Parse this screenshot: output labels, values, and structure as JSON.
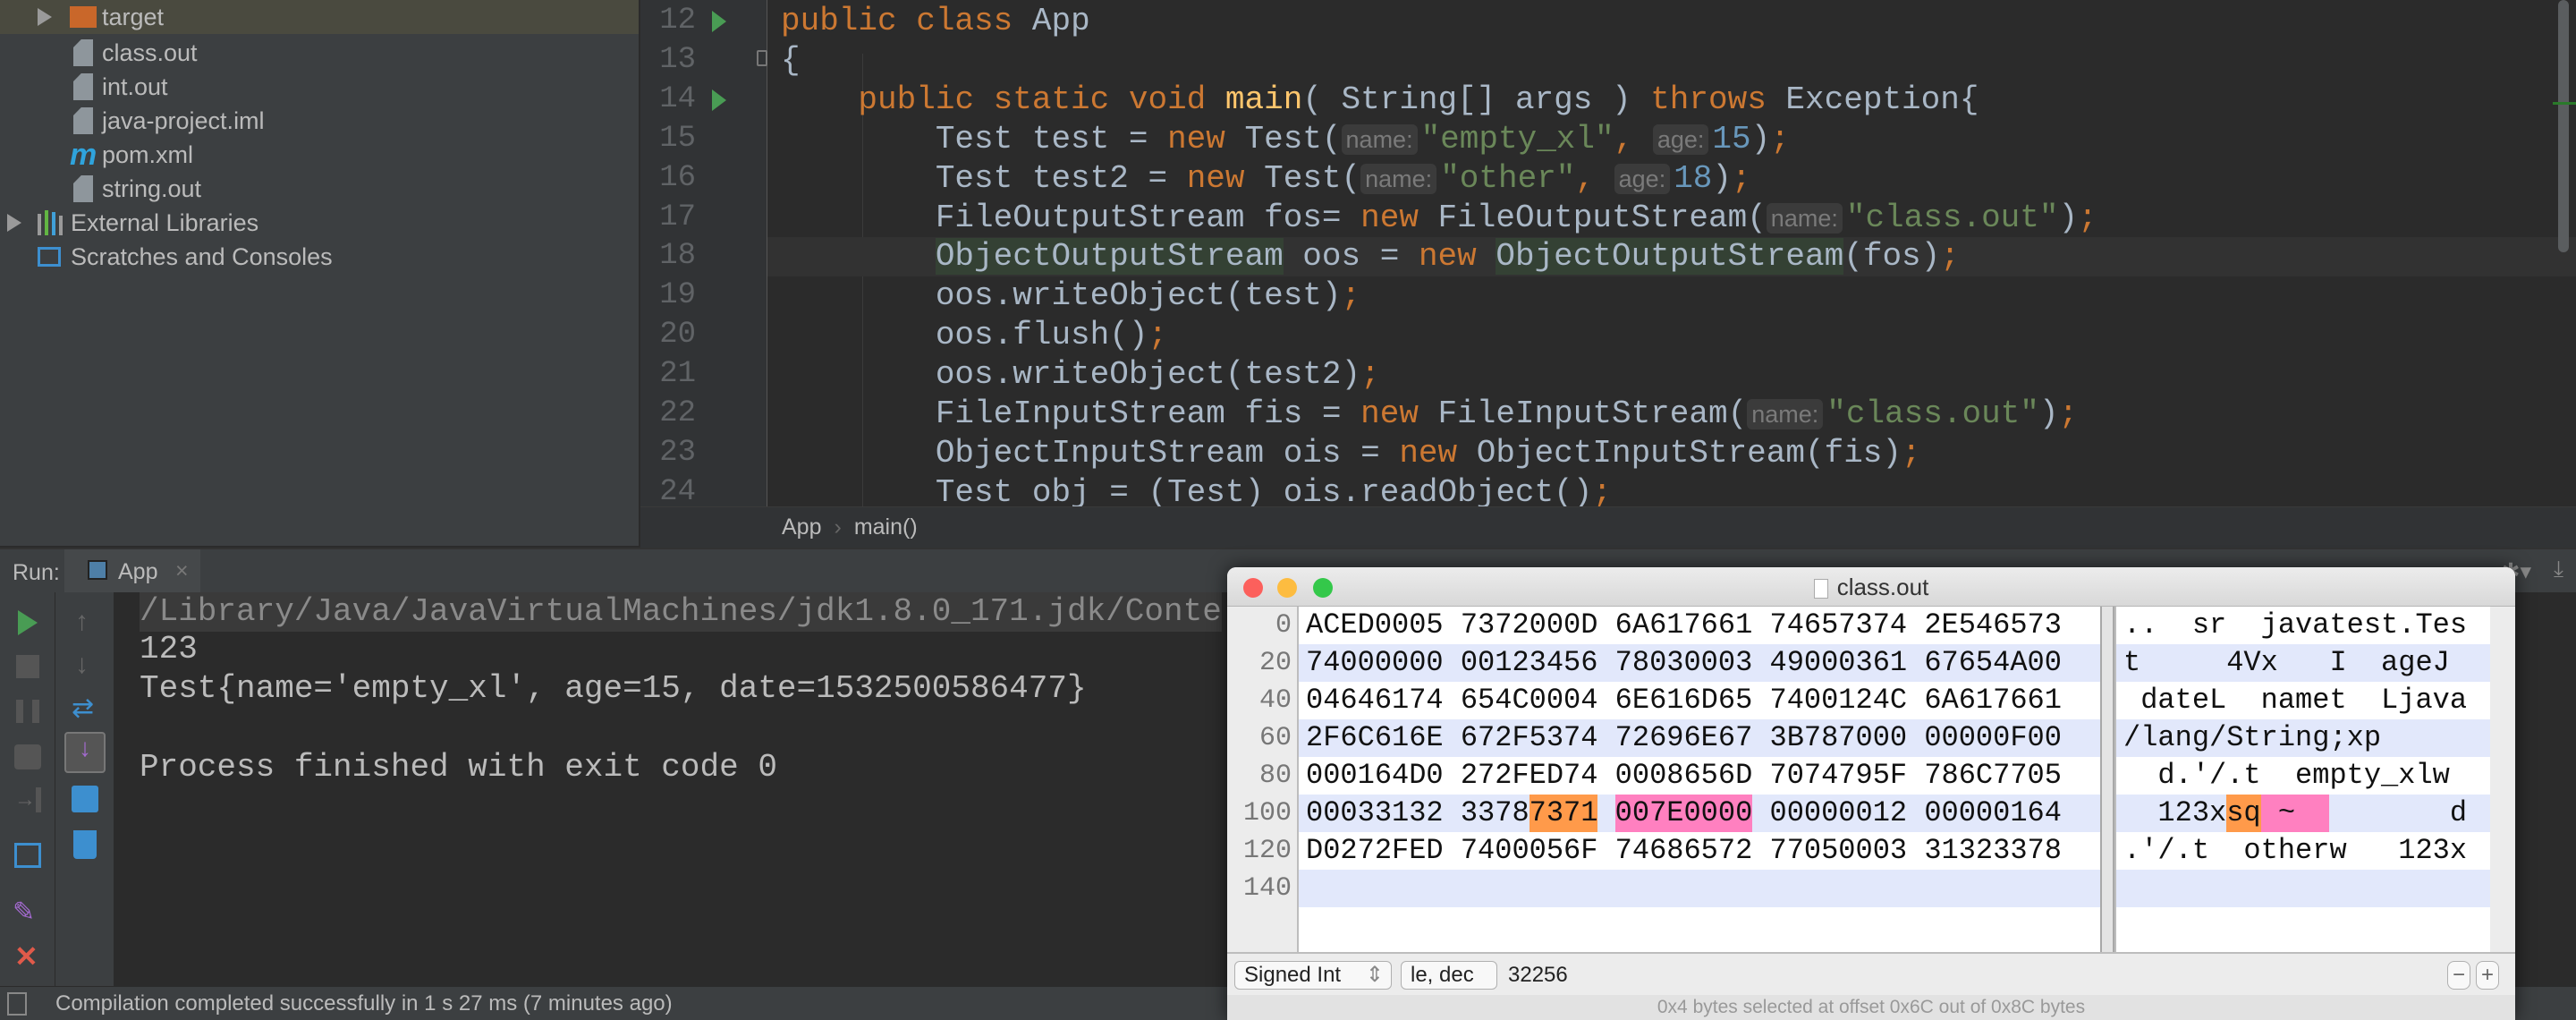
{
  "project": {
    "items": [
      {
        "label": "target",
        "icon": "folder-icon",
        "selected": true
      },
      {
        "label": "class.out",
        "icon": "file-icon"
      },
      {
        "label": "int.out",
        "icon": "file-icon"
      },
      {
        "label": "java-project.iml",
        "icon": "module-file-icon"
      },
      {
        "label": "pom.xml",
        "icon": "maven-icon"
      },
      {
        "label": "string.out",
        "icon": "file-icon"
      },
      {
        "label": "External Libraries",
        "icon": "libraries-icon"
      },
      {
        "label": "Scratches and Consoles",
        "icon": "scratches-icon"
      }
    ]
  },
  "editor": {
    "first_line": 12,
    "current_line": 18,
    "run_gutter_lines": [
      12,
      14
    ],
    "lines": [
      [
        {
          "t": "public class ",
          "c": "kw"
        },
        {
          "t": "App"
        }
      ],
      [
        {
          "t": "{"
        }
      ],
      [
        {
          "t": "    "
        },
        {
          "t": "public static void ",
          "c": "kw"
        },
        {
          "t": "main",
          "c": "fn"
        },
        {
          "t": "( String[] args ) "
        },
        {
          "t": "throws ",
          "c": "kw"
        },
        {
          "t": "Exception{"
        }
      ],
      [
        {
          "t": "        Test test = "
        },
        {
          "t": "new ",
          "c": "kw"
        },
        {
          "t": "Test("
        },
        {
          "t": "name:",
          "c": "hint"
        },
        {
          "t": "\"empty_xl\"",
          "c": "str"
        },
        {
          "t": ", ",
          "c": "sem"
        },
        {
          "t": "age:",
          "c": "hint"
        },
        {
          "t": "15",
          "c": "num"
        },
        {
          "t": ")"
        },
        {
          "t": ";",
          "c": "sem"
        }
      ],
      [
        {
          "t": "        Test test2 = "
        },
        {
          "t": "new ",
          "c": "kw"
        },
        {
          "t": "Test("
        },
        {
          "t": "name:",
          "c": "hint"
        },
        {
          "t": "\"other\"",
          "c": "str"
        },
        {
          "t": ", ",
          "c": "sem"
        },
        {
          "t": "age:",
          "c": "hint"
        },
        {
          "t": "18",
          "c": "num"
        },
        {
          "t": ")"
        },
        {
          "t": ";",
          "c": "sem"
        }
      ],
      [
        {
          "t": "        FileOutputStream fos= "
        },
        {
          "t": "new ",
          "c": "kw"
        },
        {
          "t": "FileOutputStream("
        },
        {
          "t": "name:",
          "c": "hint"
        },
        {
          "t": "\"class.out\"",
          "c": "str"
        },
        {
          "t": ")"
        },
        {
          "t": ";",
          "c": "sem"
        }
      ],
      [
        {
          "t": "        "
        },
        {
          "t": "ObjectOutputStream",
          "c": "hl"
        },
        {
          "t": " oos = "
        },
        {
          "t": "new ",
          "c": "kw"
        },
        {
          "t": "ObjectOutputStream",
          "c": "hl"
        },
        {
          "t": "(fos)"
        },
        {
          "t": ";",
          "c": "sem"
        }
      ],
      [
        {
          "t": "        oos.writeObject(test)"
        },
        {
          "t": ";",
          "c": "sem"
        }
      ],
      [
        {
          "t": "        oos.flush()"
        },
        {
          "t": ";",
          "c": "sem"
        }
      ],
      [
        {
          "t": "        oos.writeObject(test2)"
        },
        {
          "t": ";",
          "c": "sem"
        }
      ],
      [
        {
          "t": "        FileInputStream fis = "
        },
        {
          "t": "new ",
          "c": "kw"
        },
        {
          "t": "FileInputStream("
        },
        {
          "t": "name:",
          "c": "hint"
        },
        {
          "t": "\"class.out\"",
          "c": "str"
        },
        {
          "t": ")"
        },
        {
          "t": ";",
          "c": "sem"
        }
      ],
      [
        {
          "t": "        ObjectInputStream ois = "
        },
        {
          "t": "new ",
          "c": "kw"
        },
        {
          "t": "ObjectInputStream(fis)"
        },
        {
          "t": ";",
          "c": "sem"
        }
      ],
      [
        {
          "t": "        Test obj = (Test) ois.readObject()"
        },
        {
          "t": ";",
          "c": "sem"
        }
      ]
    ]
  },
  "breadcrumbs": [
    "App",
    "main()"
  ],
  "run": {
    "label": "Run:",
    "tab": "App",
    "console": [
      "/Library/Java/JavaVirtualMachines/jdk1.8.0_171.jdk/Conte",
      "123",
      "Test{name='empty_xl', age=15, date=1532500586477}",
      "",
      "Process finished with exit code 0"
    ]
  },
  "status_bar": "Compilation completed successfully in 1 s 27 ms (7 minutes ago)",
  "hex_window": {
    "title": "class.out",
    "offsets": [
      "0",
      "20",
      "40",
      "60",
      "80",
      "100",
      "120",
      "140"
    ],
    "rows": [
      {
        "hex": [
          "ACED0005",
          "7372000D",
          "6A617661",
          "74657374",
          "2E546573"
        ],
        "text": "..  sr  javatest.Tes"
      },
      {
        "hex": [
          "74000000",
          "00123456",
          "78030003",
          "49000361",
          "67654A00"
        ],
        "text": "t     4Vx   I  ageJ "
      },
      {
        "hex": [
          "04646174",
          "654C0004",
          "6E616D65",
          "7400124C",
          "6A617661"
        ],
        "text": " dateL  namet  Ljava"
      },
      {
        "hex": [
          "2F6C616E",
          "672F5374",
          "72696E67",
          "3B787000",
          "00000F00"
        ],
        "text": "/lang/String;xp     "
      },
      {
        "hex": [
          "000164D0",
          "272FED74",
          "0008656D",
          "7074795F",
          "786C7705"
        ],
        "text": "  d.'/.t  empty_xlw "
      },
      {
        "hex": [
          "00033132",
          "33787371",
          "007E0000",
          "00000012",
          "00000164"
        ],
        "text": "  123xsq ~         d"
      },
      {
        "hex": [
          "D0272FED",
          "7400056F",
          "74686572",
          "77050003",
          "31323378"
        ],
        "text": ".'/.t  otherw   123x"
      },
      {
        "hex": [],
        "text": ""
      }
    ],
    "highlights": [
      {
        "offset": 106,
        "length": 2,
        "color": "#ff9a4a"
      },
      {
        "offset": 108,
        "length": 4,
        "color": "#ff80c0"
      }
    ],
    "type_popup": "Signed Int",
    "endian_popup": "le, dec",
    "value": "32256",
    "minus": "−",
    "plus": "+",
    "status": "0x4 bytes selected at offset 0x6C out of 0x8C bytes"
  }
}
